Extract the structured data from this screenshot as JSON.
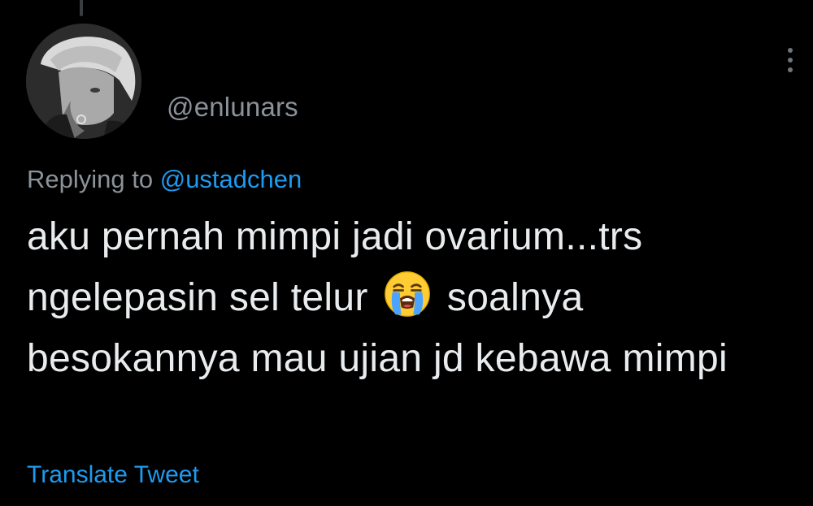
{
  "tweet": {
    "username": "@enlunars",
    "reply_prefix": "Replying to",
    "reply_handle": "@ustadchen",
    "text_part1": "aku pernah mimpi jadi ovarium...trs ngelepasin sel telur",
    "text_emoji_name": "loudly-crying-face-icon",
    "text_part2": "soalnya besokannya mau ujian jd kebawa mimpi",
    "translate_label": "Translate Tweet"
  },
  "colors": {
    "background": "#000000",
    "text": "#e9ecee",
    "secondary_text": "#8b9299",
    "link": "#1d9bf0"
  },
  "icons": {
    "avatar": "avatar",
    "more": "more-vertical-icon"
  }
}
